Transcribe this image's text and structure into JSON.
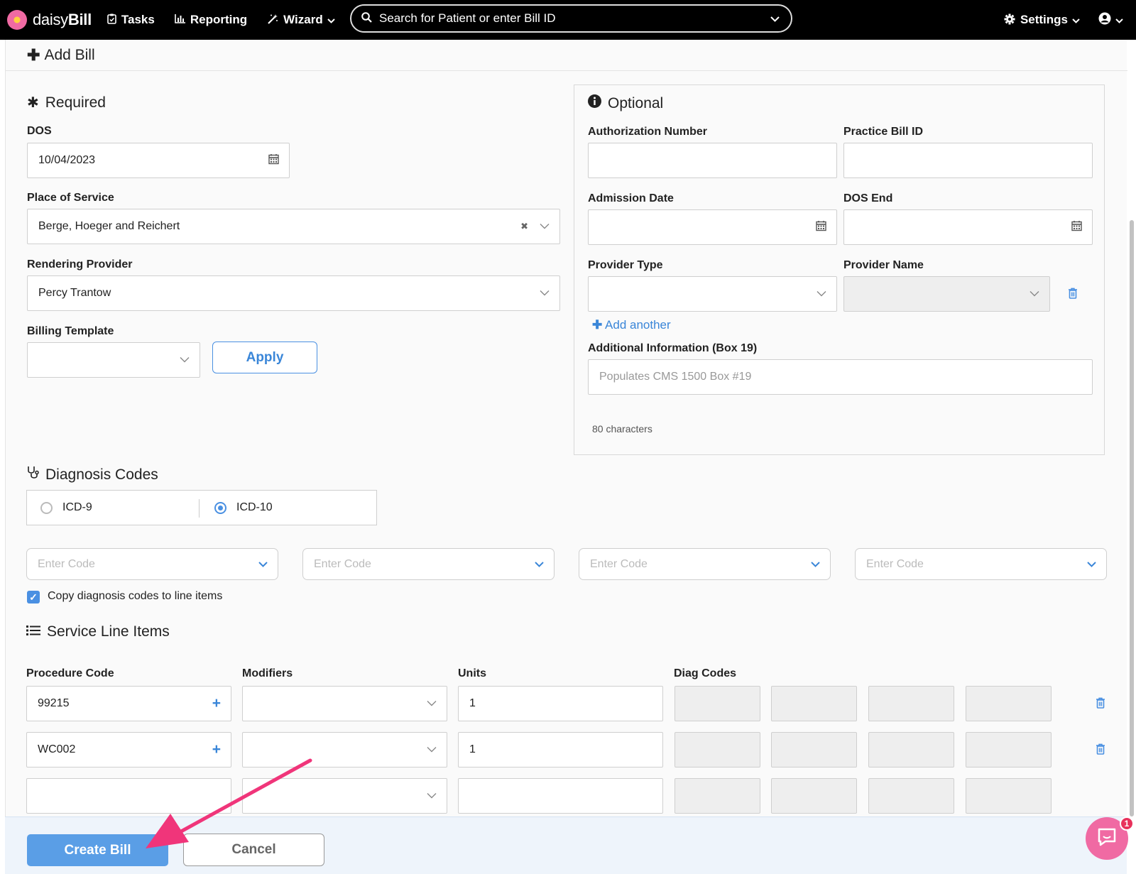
{
  "navbar": {
    "brand_prefix": "daisy",
    "brand_suffix": "Bill",
    "tasks": "Tasks",
    "reporting": "Reporting",
    "wizard": "Wizard",
    "search_placeholder": "Search for Patient or enter Bill ID",
    "settings": "Settings"
  },
  "page": {
    "title": "Add Bill"
  },
  "required": {
    "title": "Required",
    "dos_label": "DOS",
    "dos_value": "10/04/2023",
    "pos_label": "Place of Service",
    "pos_value": "Berge, Hoeger and Reichert",
    "provider_label": "Rendering Provider",
    "provider_value": "Percy Trantow",
    "template_label": "Billing Template",
    "template_value": "",
    "apply_label": "Apply"
  },
  "optional": {
    "title": "Optional",
    "auth_label": "Authorization Number",
    "auth_value": "",
    "practice_id_label": "Practice Bill ID",
    "practice_id_value": "",
    "admission_label": "Admission Date",
    "dos_end_label": "DOS End",
    "provider_type_label": "Provider Type",
    "provider_name_label": "Provider Name",
    "add_another": "Add another",
    "box19_label": "Additional Information (Box 19)",
    "box19_placeholder": "Populates CMS 1500 Box #19",
    "chars": "80 characters"
  },
  "diagnosis": {
    "title": "Diagnosis Codes",
    "options": [
      "ICD-9",
      "ICD-10"
    ],
    "selected": "ICD-10",
    "code_placeholder": "Enter Code",
    "copy_label": "Copy diagnosis codes to line items",
    "copy_checked": true
  },
  "service": {
    "title": "Service Line Items",
    "headers": [
      "Procedure Code",
      "Modifiers",
      "Units",
      "Diag Codes"
    ],
    "rows": [
      {
        "procedure": "99215",
        "modifiers": "",
        "units": "1"
      },
      {
        "procedure": "WC002",
        "modifiers": "",
        "units": "1"
      },
      {
        "procedure": "",
        "modifiers": "",
        "units": ""
      }
    ]
  },
  "footer": {
    "create": "Create Bill",
    "cancel": "Cancel",
    "chat_badge": "1"
  },
  "colors": {
    "accent": "#4a90e2",
    "arrow": "#f0357a",
    "chat": "#f06aa3"
  }
}
